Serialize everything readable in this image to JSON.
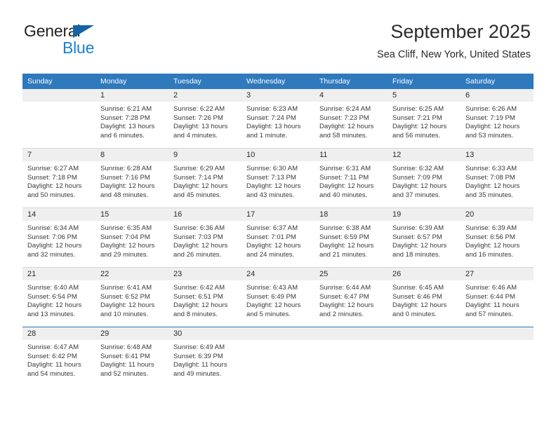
{
  "brand": {
    "name_top": "General",
    "name_bottom": "Blue",
    "triangle_color": "#1464a5",
    "blue_color": "#1a7fd4"
  },
  "header": {
    "title": "September 2025",
    "subtitle": "Sea Cliff, New York, United States"
  },
  "theme": {
    "header_blue": "#2f79bd",
    "daynum_band": "#efefef",
    "row_divider": "#d6d6d6"
  },
  "weekday_headers": [
    "Sunday",
    "Monday",
    "Tuesday",
    "Wednesday",
    "Thursday",
    "Friday",
    "Saturday"
  ],
  "weeks": [
    [
      {
        "day": "",
        "sunrise": "",
        "sunset": "",
        "daylight_line1": "",
        "daylight_line2": ""
      },
      {
        "day": "1",
        "sunrise": "Sunrise: 6:21 AM",
        "sunset": "Sunset: 7:28 PM",
        "daylight_line1": "Daylight: 13 hours",
        "daylight_line2": "and 6 minutes."
      },
      {
        "day": "2",
        "sunrise": "Sunrise: 6:22 AM",
        "sunset": "Sunset: 7:26 PM",
        "daylight_line1": "Daylight: 13 hours",
        "daylight_line2": "and 4 minutes."
      },
      {
        "day": "3",
        "sunrise": "Sunrise: 6:23 AM",
        "sunset": "Sunset: 7:24 PM",
        "daylight_line1": "Daylight: 13 hours",
        "daylight_line2": "and 1 minute."
      },
      {
        "day": "4",
        "sunrise": "Sunrise: 6:24 AM",
        "sunset": "Sunset: 7:23 PM",
        "daylight_line1": "Daylight: 12 hours",
        "daylight_line2": "and 58 minutes."
      },
      {
        "day": "5",
        "sunrise": "Sunrise: 6:25 AM",
        "sunset": "Sunset: 7:21 PM",
        "daylight_line1": "Daylight: 12 hours",
        "daylight_line2": "and 56 minutes."
      },
      {
        "day": "6",
        "sunrise": "Sunrise: 6:26 AM",
        "sunset": "Sunset: 7:19 PM",
        "daylight_line1": "Daylight: 12 hours",
        "daylight_line2": "and 53 minutes."
      }
    ],
    [
      {
        "day": "7",
        "sunrise": "Sunrise: 6:27 AM",
        "sunset": "Sunset: 7:18 PM",
        "daylight_line1": "Daylight: 12 hours",
        "daylight_line2": "and 50 minutes."
      },
      {
        "day": "8",
        "sunrise": "Sunrise: 6:28 AM",
        "sunset": "Sunset: 7:16 PM",
        "daylight_line1": "Daylight: 12 hours",
        "daylight_line2": "and 48 minutes."
      },
      {
        "day": "9",
        "sunrise": "Sunrise: 6:29 AM",
        "sunset": "Sunset: 7:14 PM",
        "daylight_line1": "Daylight: 12 hours",
        "daylight_line2": "and 45 minutes."
      },
      {
        "day": "10",
        "sunrise": "Sunrise: 6:30 AM",
        "sunset": "Sunset: 7:13 PM",
        "daylight_line1": "Daylight: 12 hours",
        "daylight_line2": "and 43 minutes."
      },
      {
        "day": "11",
        "sunrise": "Sunrise: 6:31 AM",
        "sunset": "Sunset: 7:11 PM",
        "daylight_line1": "Daylight: 12 hours",
        "daylight_line2": "and 40 minutes."
      },
      {
        "day": "12",
        "sunrise": "Sunrise: 6:32 AM",
        "sunset": "Sunset: 7:09 PM",
        "daylight_line1": "Daylight: 12 hours",
        "daylight_line2": "and 37 minutes."
      },
      {
        "day": "13",
        "sunrise": "Sunrise: 6:33 AM",
        "sunset": "Sunset: 7:08 PM",
        "daylight_line1": "Daylight: 12 hours",
        "daylight_line2": "and 35 minutes."
      }
    ],
    [
      {
        "day": "14",
        "sunrise": "Sunrise: 6:34 AM",
        "sunset": "Sunset: 7:06 PM",
        "daylight_line1": "Daylight: 12 hours",
        "daylight_line2": "and 32 minutes."
      },
      {
        "day": "15",
        "sunrise": "Sunrise: 6:35 AM",
        "sunset": "Sunset: 7:04 PM",
        "daylight_line1": "Daylight: 12 hours",
        "daylight_line2": "and 29 minutes."
      },
      {
        "day": "16",
        "sunrise": "Sunrise: 6:36 AM",
        "sunset": "Sunset: 7:03 PM",
        "daylight_line1": "Daylight: 12 hours",
        "daylight_line2": "and 26 minutes."
      },
      {
        "day": "17",
        "sunrise": "Sunrise: 6:37 AM",
        "sunset": "Sunset: 7:01 PM",
        "daylight_line1": "Daylight: 12 hours",
        "daylight_line2": "and 24 minutes."
      },
      {
        "day": "18",
        "sunrise": "Sunrise: 6:38 AM",
        "sunset": "Sunset: 6:59 PM",
        "daylight_line1": "Daylight: 12 hours",
        "daylight_line2": "and 21 minutes."
      },
      {
        "day": "19",
        "sunrise": "Sunrise: 6:39 AM",
        "sunset": "Sunset: 6:57 PM",
        "daylight_line1": "Daylight: 12 hours",
        "daylight_line2": "and 18 minutes."
      },
      {
        "day": "20",
        "sunrise": "Sunrise: 6:39 AM",
        "sunset": "Sunset: 6:56 PM",
        "daylight_line1": "Daylight: 12 hours",
        "daylight_line2": "and 16 minutes."
      }
    ],
    [
      {
        "day": "21",
        "sunrise": "Sunrise: 6:40 AM",
        "sunset": "Sunset: 6:54 PM",
        "daylight_line1": "Daylight: 12 hours",
        "daylight_line2": "and 13 minutes."
      },
      {
        "day": "22",
        "sunrise": "Sunrise: 6:41 AM",
        "sunset": "Sunset: 6:52 PM",
        "daylight_line1": "Daylight: 12 hours",
        "daylight_line2": "and 10 minutes."
      },
      {
        "day": "23",
        "sunrise": "Sunrise: 6:42 AM",
        "sunset": "Sunset: 6:51 PM",
        "daylight_line1": "Daylight: 12 hours",
        "daylight_line2": "and 8 minutes."
      },
      {
        "day": "24",
        "sunrise": "Sunrise: 6:43 AM",
        "sunset": "Sunset: 6:49 PM",
        "daylight_line1": "Daylight: 12 hours",
        "daylight_line2": "and 5 minutes."
      },
      {
        "day": "25",
        "sunrise": "Sunrise: 6:44 AM",
        "sunset": "Sunset: 6:47 PM",
        "daylight_line1": "Daylight: 12 hours",
        "daylight_line2": "and 2 minutes."
      },
      {
        "day": "26",
        "sunrise": "Sunrise: 6:45 AM",
        "sunset": "Sunset: 6:46 PM",
        "daylight_line1": "Daylight: 12 hours",
        "daylight_line2": "and 0 minutes."
      },
      {
        "day": "27",
        "sunrise": "Sunrise: 6:46 AM",
        "sunset": "Sunset: 6:44 PM",
        "daylight_line1": "Daylight: 11 hours",
        "daylight_line2": "and 57 minutes."
      }
    ],
    [
      {
        "day": "28",
        "sunrise": "Sunrise: 6:47 AM",
        "sunset": "Sunset: 6:42 PM",
        "daylight_line1": "Daylight: 11 hours",
        "daylight_line2": "and 54 minutes."
      },
      {
        "day": "29",
        "sunrise": "Sunrise: 6:48 AM",
        "sunset": "Sunset: 6:41 PM",
        "daylight_line1": "Daylight: 11 hours",
        "daylight_line2": "and 52 minutes."
      },
      {
        "day": "30",
        "sunrise": "Sunrise: 6:49 AM",
        "sunset": "Sunset: 6:39 PM",
        "daylight_line1": "Daylight: 11 hours",
        "daylight_line2": "and 49 minutes."
      },
      {
        "day": "",
        "sunrise": "",
        "sunset": "",
        "daylight_line1": "",
        "daylight_line2": ""
      },
      {
        "day": "",
        "sunrise": "",
        "sunset": "",
        "daylight_line1": "",
        "daylight_line2": ""
      },
      {
        "day": "",
        "sunrise": "",
        "sunset": "",
        "daylight_line1": "",
        "daylight_line2": ""
      },
      {
        "day": "",
        "sunrise": "",
        "sunset": "",
        "daylight_line1": "",
        "daylight_line2": ""
      }
    ]
  ]
}
